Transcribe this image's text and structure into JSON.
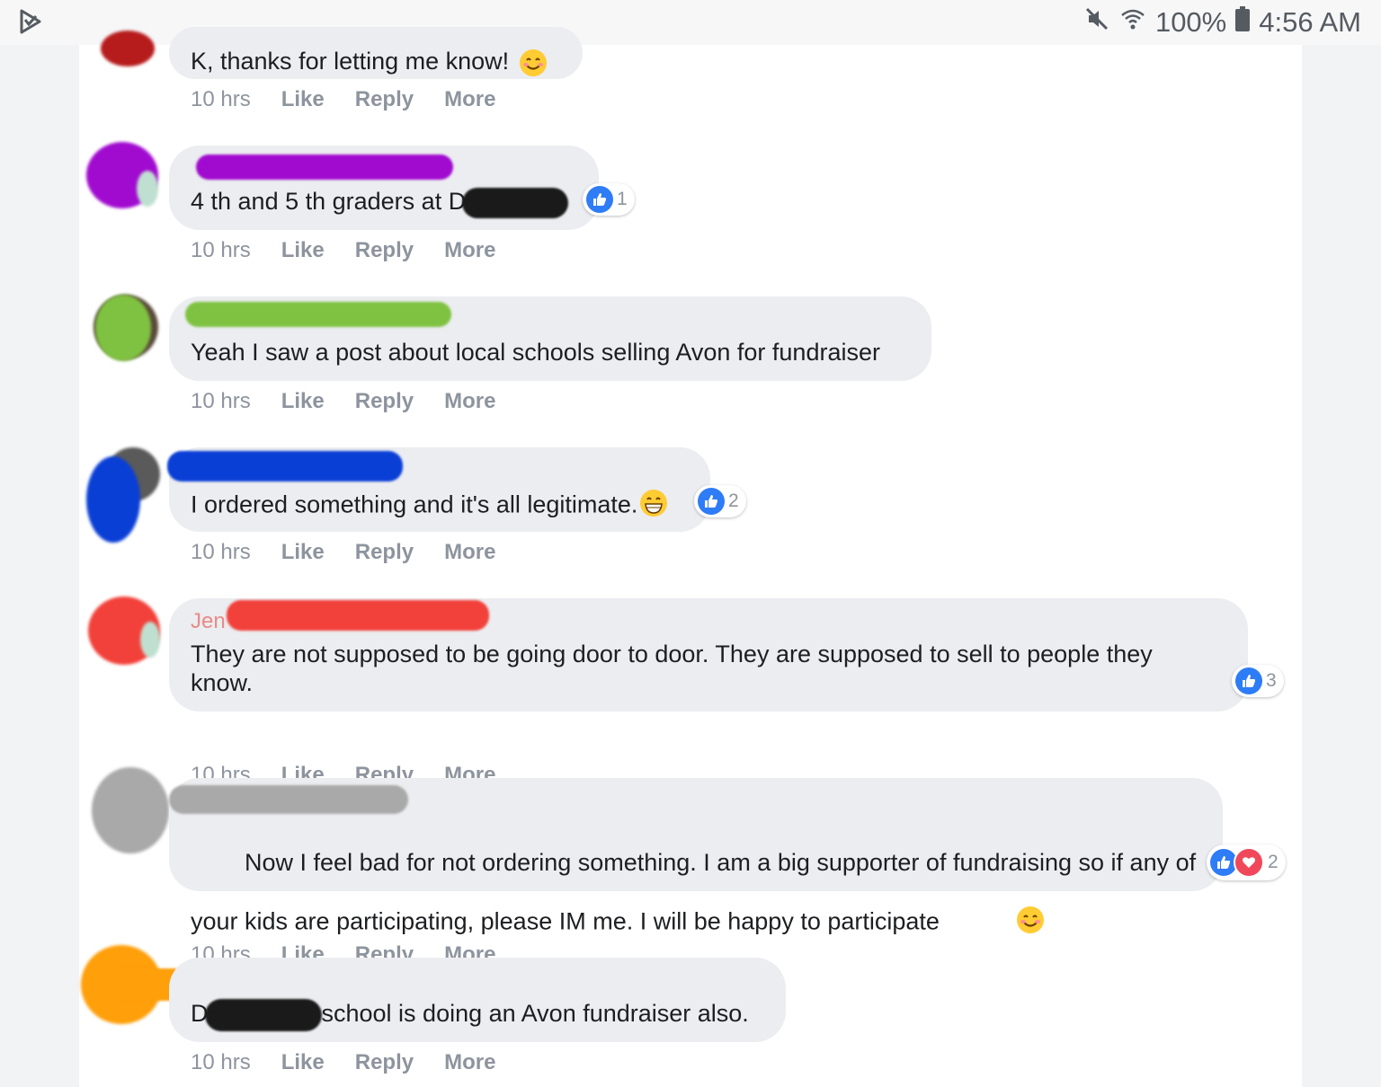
{
  "status_bar": {
    "battery": "100%",
    "time": "4:56 AM",
    "icons": [
      "play-store-icon",
      "mute-icon",
      "wifi-icon",
      "battery-icon"
    ]
  },
  "comments": [
    {
      "text": "K, thanks for letting me know!",
      "emoji": "smiling-face-icon",
      "time": "10 hrs",
      "like": "Like",
      "reply": "Reply",
      "more": "More"
    },
    {
      "text_before": "4 th and 5 th graders at D",
      "reaction_count": "1",
      "time": "10 hrs",
      "like": "Like",
      "reply": "Reply",
      "more": "More"
    },
    {
      "text": "Yeah I saw a post about local schools selling Avon for fundraiser",
      "time": "10 hrs",
      "like": "Like",
      "reply": "Reply",
      "more": "More"
    },
    {
      "text": "I ordered something and it's all legitimate.",
      "emoji": "grinning-face-icon",
      "reaction_count": "2",
      "time": "10 hrs",
      "like": "Like",
      "reply": "Reply",
      "more": "More"
    },
    {
      "name_partial": "Jen",
      "text": "They are not supposed to be going door to door. They are supposed to sell to people they know.",
      "reaction_count": "3",
      "time": "10 hrs",
      "like": "Like",
      "reply": "Reply",
      "more": "More"
    },
    {
      "text": "Now I feel bad for not ordering something. I am a big supporter of fundraising so if any of your kids are participating, please IM me. I will be happy to participate",
      "emoji": "smiling-face-icon",
      "reaction_count": "2",
      "time": "10 hrs",
      "like": "Like",
      "reply": "Reply",
      "more": "More"
    },
    {
      "text_before": "D",
      "text_after": "school is doing an Avon fundraiser also.",
      "time": "10 hrs",
      "like": "Like",
      "reply": "Reply",
      "more": "More"
    }
  ],
  "colors": {
    "bubble": "#ebedf0",
    "action_text": "#8d949e",
    "like_blue": "#2e7cf6",
    "love_red": "#f0485a",
    "redact_purple": "#a10bcf",
    "redact_green": "#7fc241",
    "redact_blue": "#0a3fd6",
    "redact_red": "#f2413a",
    "redact_gray": "#a9a9a9",
    "redact_orange": "#ff9f0a"
  }
}
